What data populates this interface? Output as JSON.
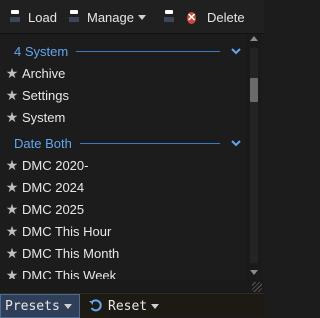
{
  "toolbar": {
    "load_label": "Load",
    "manage_label": "Manage",
    "delete_label": "Delete",
    "icons": {
      "load": "floppy-disk-icon",
      "manage": "floppy-disk-icon",
      "save": "floppy-disk-icon",
      "delete": "delete-x-icon"
    }
  },
  "groups": [
    {
      "title": "4 System",
      "items": [
        {
          "label": "Archive"
        },
        {
          "label": "Settings"
        },
        {
          "label": "System"
        }
      ]
    },
    {
      "title": "Date Both",
      "items": [
        {
          "label": "DMC 2020-"
        },
        {
          "label": "DMC 2024"
        },
        {
          "label": "DMC 2025"
        },
        {
          "label": "DMC This Hour"
        },
        {
          "label": "DMC This Month"
        },
        {
          "label": "DMC This Week"
        }
      ]
    }
  ],
  "footer": {
    "presets_label": "Presets",
    "reset_label": "Reset"
  },
  "colors": {
    "accent": "#62a6f0",
    "background": "#1c1c1c",
    "presets_bg": "#2f3f57",
    "delete_red": "#c84b3a"
  }
}
